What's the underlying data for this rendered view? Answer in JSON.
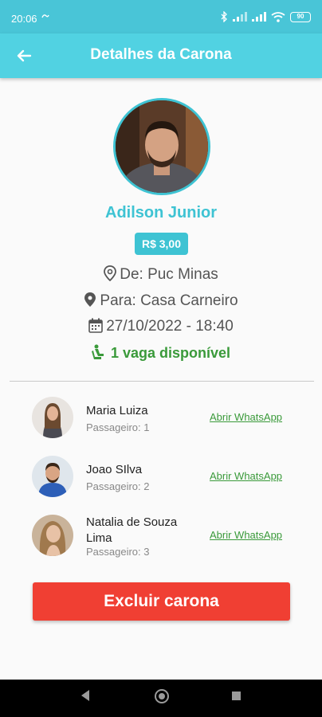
{
  "status": {
    "time": "20:06",
    "battery": "90"
  },
  "header": {
    "title": "Detalhes da Carona"
  },
  "driver": {
    "name": "Adilson Junior",
    "price": "R$ 3,00",
    "from": "De: Puc Minas",
    "to": "Para: Casa Carneiro",
    "datetime": "27/10/2022  -  18:40",
    "seats": "1 vaga disponível"
  },
  "passengers": [
    {
      "name": "Maria Luiza",
      "role": "Passageiro: 1",
      "link": "Abrir WhatsApp"
    },
    {
      "name": "Joao SIlva",
      "role": "Passageiro: 2",
      "link": "Abrir WhatsApp"
    },
    {
      "name": "Natalia de Souza Lima",
      "role": "Passageiro: 3",
      "link": "Abrir WhatsApp"
    }
  ],
  "actions": {
    "delete_label": "Excluir carona"
  },
  "colors": {
    "accent": "#3ec3d3",
    "appbar": "#51d2e2",
    "success": "#3a9a3a",
    "danger": "#f03f33"
  }
}
